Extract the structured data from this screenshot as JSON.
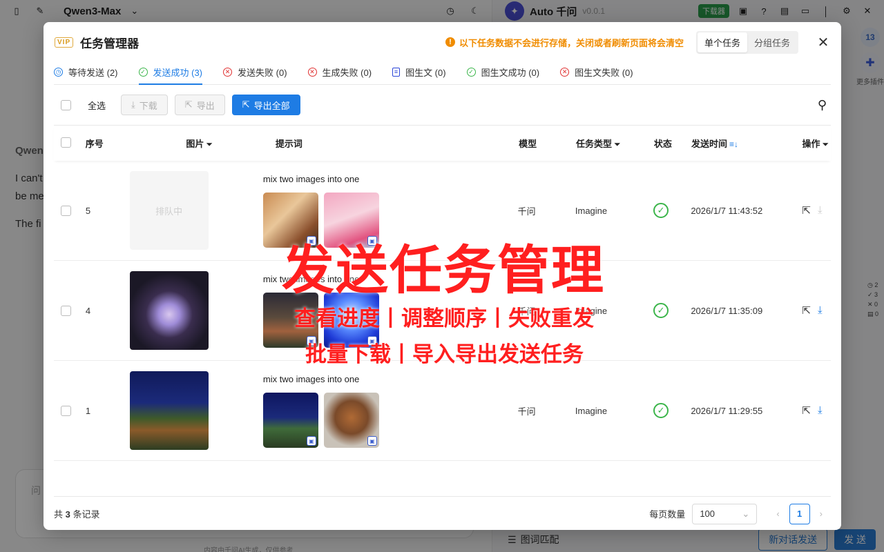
{
  "bg_left": {
    "model_name": "Qwen3-Max",
    "chat_who": "Qwen",
    "chat_line1": "I can't",
    "chat_line2": "be me",
    "chat_line3": "The fi",
    "composer_placeholder": "问",
    "footer_note": "内容由千问AI生成，仅供参考"
  },
  "bg_right": {
    "app_title": "Auto 千问",
    "version": "v0.0.1",
    "download_badge": "下载器",
    "side_count": "13",
    "more_plugins": "更多插件",
    "stats": [
      "2",
      "3",
      "0",
      "0"
    ],
    "match_label": "图词匹配",
    "new_chat_send": "新对话发送",
    "send": "发 送"
  },
  "modal": {
    "vip_label": "VIP",
    "title": "任务管理器",
    "notice": "以下任务数据不会进行存储，关闭或者刷新页面将会清空",
    "seg_single": "单个任务",
    "seg_group": "分组任务",
    "tabs": [
      {
        "label": "等待发送 (2)",
        "icon": "clock-icon"
      },
      {
        "label": "发送成功 (3)",
        "icon": "check-circle-icon"
      },
      {
        "label": "发送失败 (0)",
        "icon": "x-circle-icon"
      },
      {
        "label": "生成失败 (0)",
        "icon": "x-circle-icon"
      },
      {
        "label": "图生文 (0)",
        "icon": "document-icon"
      },
      {
        "label": "图生文成功 (0)",
        "icon": "check-circle-icon"
      },
      {
        "label": "图生文失败 (0)",
        "icon": "x-circle-icon"
      }
    ],
    "toolbar": {
      "select_all": "全选",
      "download": "下载",
      "export": "导出",
      "export_all": "导出全部"
    },
    "columns": {
      "no": "序号",
      "image": "图片",
      "prompt": "提示词",
      "model": "模型",
      "type": "任务类型",
      "status": "状态",
      "time": "发送时间",
      "ops": "操作"
    },
    "rows": [
      {
        "no": "5",
        "image_state": "排队中",
        "prompt": "mix two images into one",
        "model": "千问",
        "type": "Imagine",
        "time": "2026/1/7 11:43:52"
      },
      {
        "no": "4",
        "image_state": "",
        "prompt": "mix two images into one",
        "model": "千问",
        "type": "Imagine",
        "time": "2026/1/7 11:35:09"
      },
      {
        "no": "1",
        "image_state": "",
        "prompt": "mix two images into one",
        "model": "千问",
        "type": "Imagine",
        "time": "2026/1/7 11:29:55"
      }
    ],
    "footer": {
      "total_prefix": "共",
      "total_count": "3",
      "total_suffix": "条记录",
      "per_page_label": "每页数量",
      "per_page_value": "100",
      "current_page": "1"
    }
  },
  "promo": {
    "headline": "发送任务管理",
    "line2": "查看进度丨调整顺序丨失败重发",
    "line3": "批量下载丨导入导出发送任务"
  },
  "colors": {
    "accent": "#1e7ce4",
    "success": "#3bb54a",
    "error": "#e03131",
    "warning": "#f08c00",
    "promo": "#ff1f1f"
  }
}
